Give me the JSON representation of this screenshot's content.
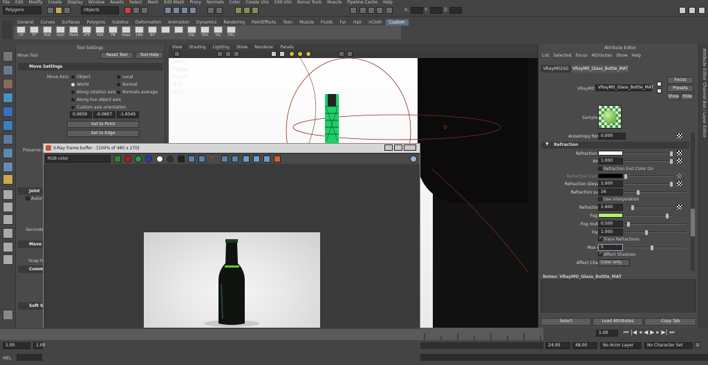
{
  "menubar": [
    "File",
    "Edit",
    "Modify",
    "Create",
    "Display",
    "Window",
    "Assets",
    "Select",
    "Mesh",
    "Edit Mesh",
    "Proxy",
    "Normals",
    "Color",
    "Create UVs",
    "Edit UVs",
    "Bonus Tools",
    "Muscle",
    "Pipeline Cache",
    "Help"
  ],
  "status": {
    "mode": "Polygons",
    "selection_mask": "Objects",
    "x_label": "X:",
    "y_label": "Y:",
    "z_label": "Z:"
  },
  "shelf_tabs": [
    "General",
    "Curves",
    "Surfaces",
    "Polygons",
    "Subdivs",
    "Deformation",
    "Animation",
    "Dynamics",
    "Rendering",
    "PaintEffects",
    "Toon",
    "Muscle",
    "Fluids",
    "Fur",
    "Hair",
    "nCloth",
    "Custom"
  ],
  "shelf_active": "Custom",
  "shelf_buttons": [
    "CP",
    "FT",
    "Hist",
    "Outl",
    "Hshd",
    "UTE",
    "SSA",
    "FB",
    "Impo",
    "LRA",
    "EP",
    "",
    "",
    "VSL",
    "VDL",
    "VIL",
    "VRL"
  ],
  "tool_settings": {
    "header": "Tool Settings",
    "tool_name": "Move Tool",
    "reset_label": "Reset Tool",
    "help_label": "Tool Help",
    "section": "Move Settings",
    "move_axis_label": "Move Axis:",
    "options": [
      "Object",
      "Local",
      "World",
      "Normal",
      "Along rotation axis",
      "Normals average",
      "Along live object axis",
      "Custom axis orientation"
    ],
    "values": [
      "0.0659",
      "-0.0607",
      "-1.6545"
    ],
    "set_to_point": "Set to Point",
    "set_to_edge": "Set to Edge",
    "preserve_label": "Preserve c",
    "joint_section": "Joint",
    "auto_label": "Autor",
    "move_section": "Move",
    "snap_label": "Snap to",
    "common_section": "Comm",
    "soft_section": "Soft S",
    "secondary_label": "Seconda"
  },
  "viewport": {
    "menu": [
      "View",
      "Shading",
      "Lighting",
      "Show",
      "Renderer",
      "Panels"
    ],
    "hud": [
      "Verts:",
      "Edges:",
      "Faces:",
      "Tris:",
      "UVs:"
    ]
  },
  "vfb": {
    "title": "V-Ray frame buffer - [100% of 480 x 270]",
    "channel": "RGB color"
  },
  "attribute_editor": {
    "header": "Attribute Editor",
    "menu": [
      "List",
      "Selected",
      "Focus",
      "Attributes",
      "Show",
      "Help"
    ],
    "tabs": [
      "VRayMtl2SG",
      "VRayMtl_Glass_Bottle_MAT"
    ],
    "material_label": "VRayMtl:",
    "material_name": "VRayMtl_Glass_Bottle_MAT",
    "focus": "Focus",
    "presets": "Presets",
    "show": "Show",
    "hide": "Hide",
    "sample_label": "Sample",
    "anisotropy_label": "Anisotropy Rotation",
    "anisotropy_value": "0.000",
    "section": "Refraction",
    "rows": {
      "refraction_color": "Refraction Color",
      "amount_label": "Amount",
      "amount": "1.000",
      "exit_on": "Refraction Exit Color On",
      "exit_color": "Refraction Exit Color",
      "gloss_label": "Refraction Glossiness",
      "gloss": "1.000",
      "subdivs_label": "Refraction subdivs",
      "subdivs": "16",
      "interp": "Use interpolation",
      "ior_label": "Refraction IOR",
      "ior": "1.600",
      "fog_color": "Fog color",
      "fog_mult_label": "Fog multiplier",
      "fog_mult": "0.500",
      "fog_bias_label": "Fog bias",
      "fog_bias": "1.000",
      "trace": "Trace Refractions",
      "max_depth_label": "Max depth",
      "max_depth": "5",
      "affect_shadows": "Affect Shadows",
      "affect_channels_label": "Affect Channels",
      "affect_channels": "Color only"
    },
    "notes": "Notes: VRayMtl_Glass_Bottle_MAT",
    "select": "Select",
    "load": "Load Attributes",
    "copy_tab": "Copy Tab"
  },
  "right_strip": "Channel Box / Layer Editor",
  "right_strip2": "Attribute Editor",
  "bottom": {
    "range_start": "1.00",
    "range_start2": "1.00",
    "current": "1.00",
    "end1": "24.00",
    "end2": "48.00",
    "anim_layer": "No Anim Layer",
    "char_set": "No Character Set",
    "mel": "MEL"
  },
  "colors": {
    "fog": "#b5f06a",
    "refraction": "#ffffff",
    "exit": "#000000",
    "accent": "#5d6d7e"
  }
}
